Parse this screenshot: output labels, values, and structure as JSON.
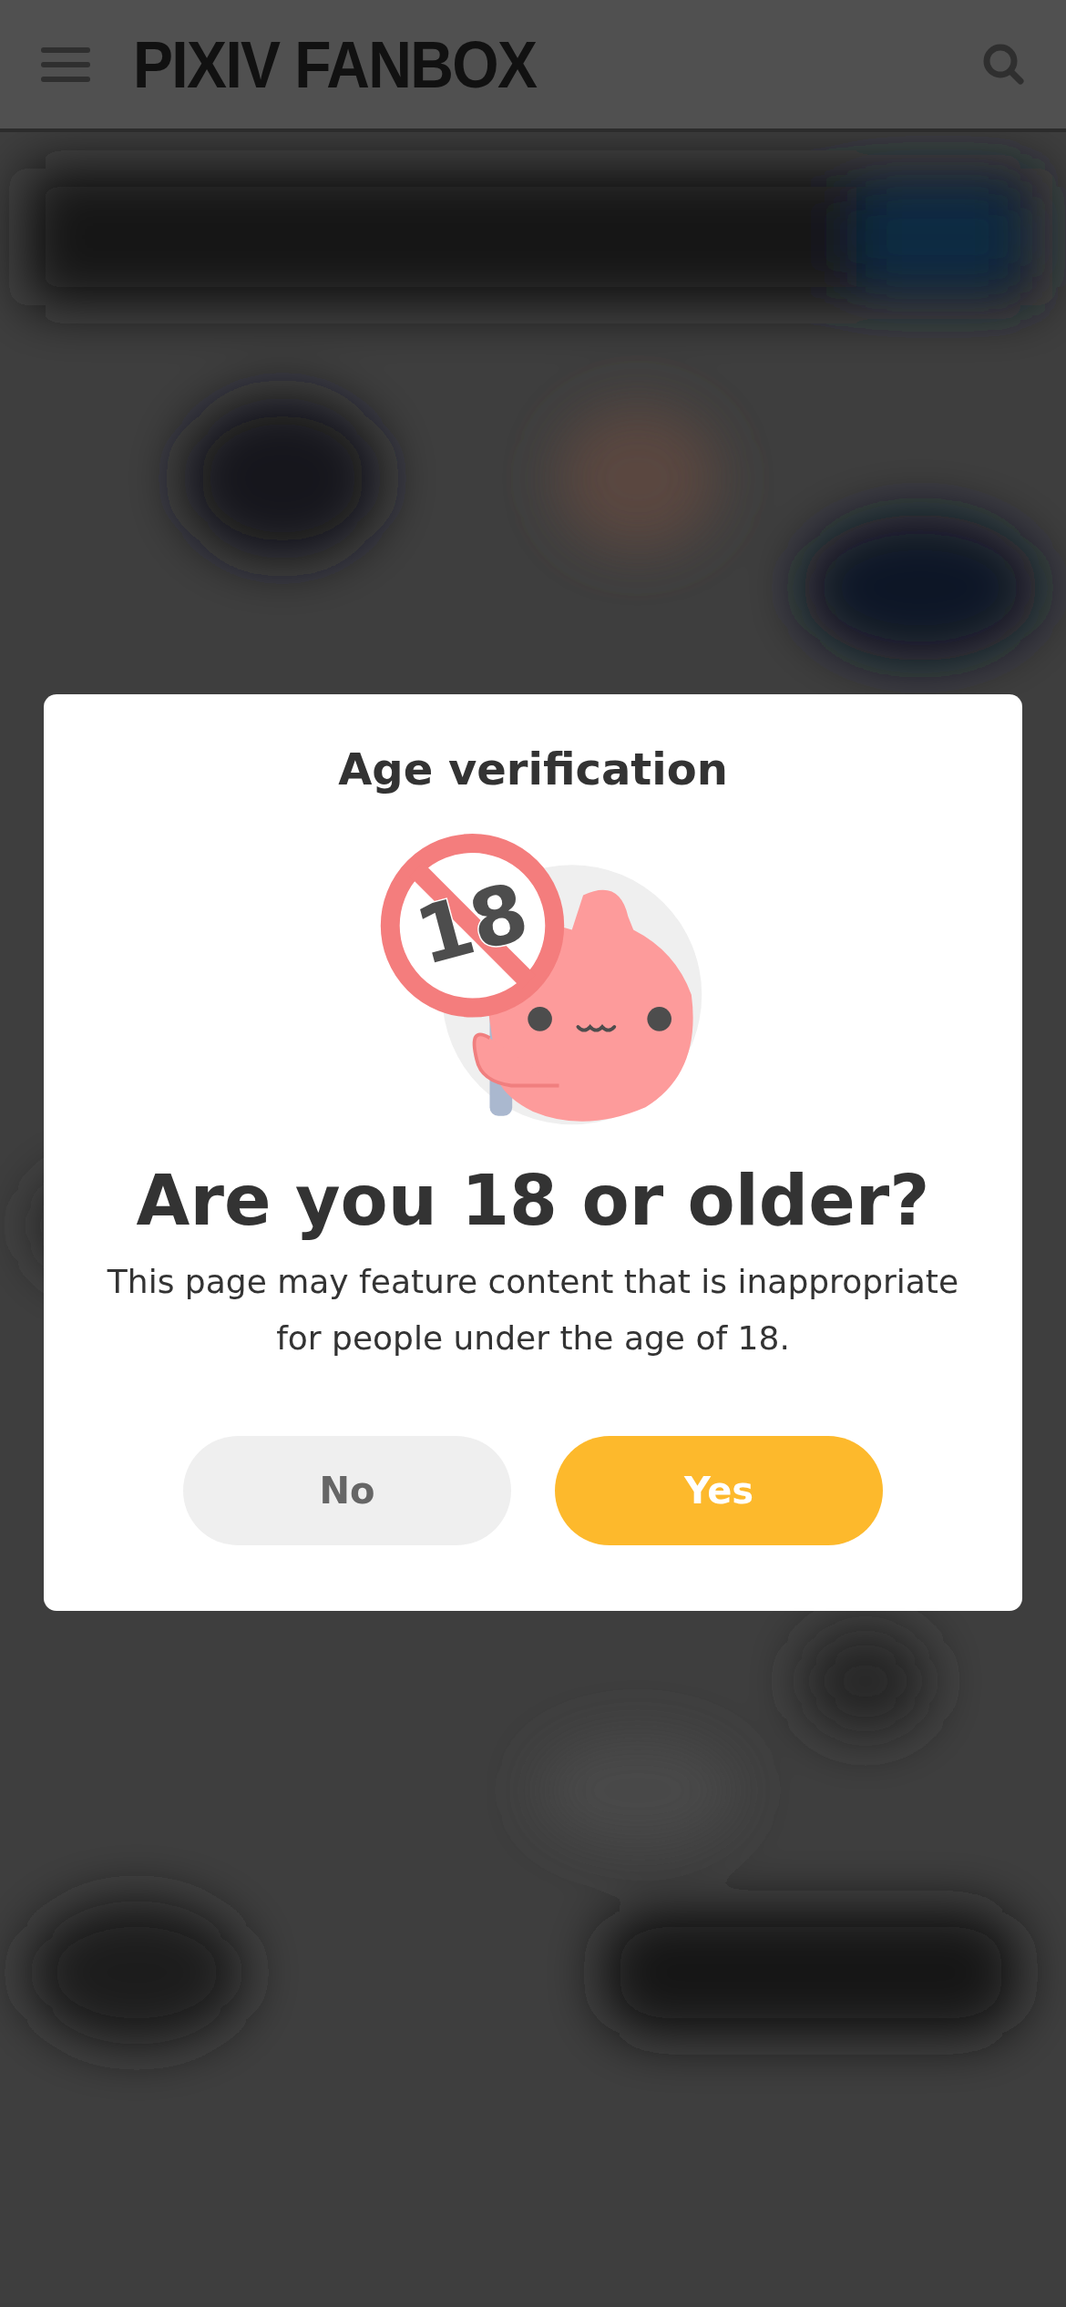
{
  "header": {
    "logo": "PIXIV FANBOX"
  },
  "dialog": {
    "title": "Age verification",
    "illustration": {
      "sign_text": "18"
    },
    "heading": "Are you 18 or older?",
    "message": "This page may feature content that is inappropriate for people under the age of 18.",
    "buttons": [
      {
        "label": "No",
        "kind": "secondary"
      },
      {
        "label": "Yes",
        "kind": "primary"
      }
    ]
  }
}
